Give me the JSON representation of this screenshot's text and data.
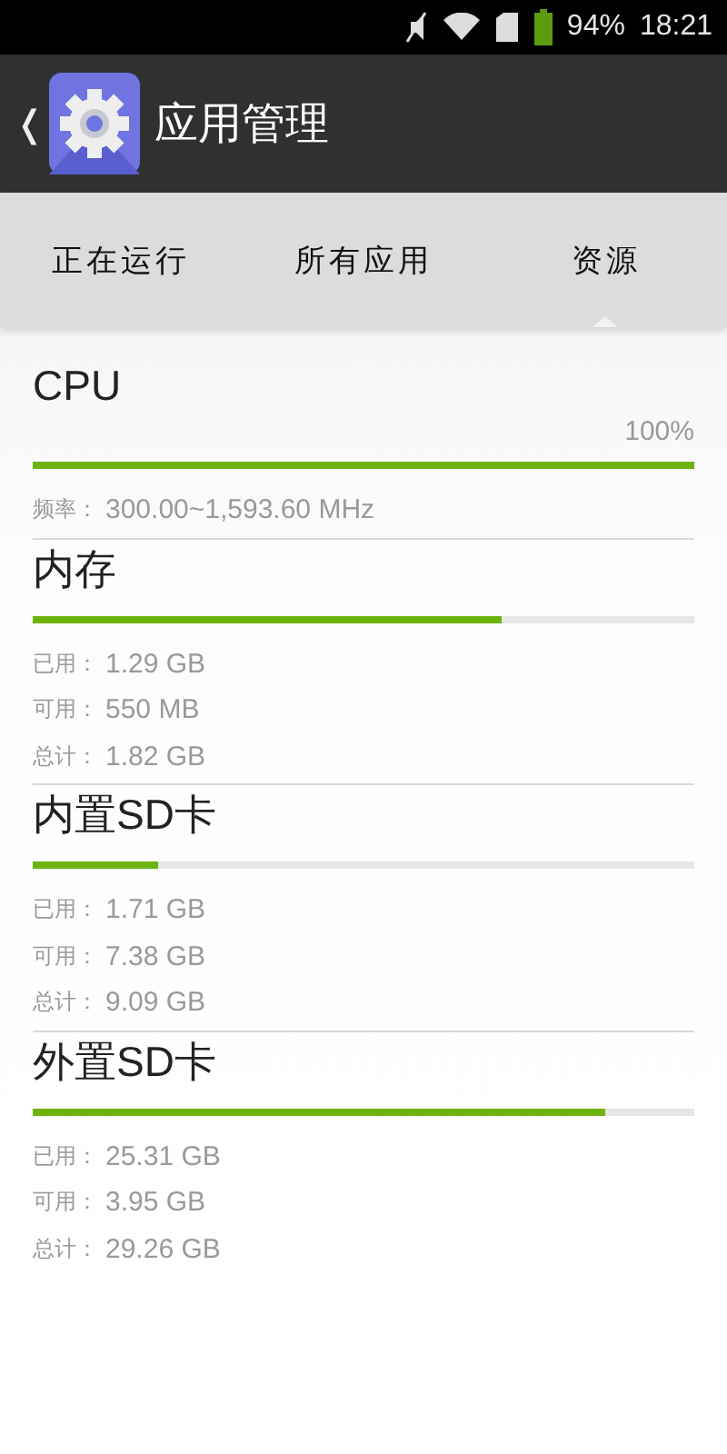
{
  "status_bar": {
    "battery": "94%",
    "time": "18:21"
  },
  "app_bar": {
    "title": "应用管理",
    "back": "❬"
  },
  "tabs": [
    {
      "label": "正在运行",
      "selected": false
    },
    {
      "label": "所有应用",
      "selected": false
    },
    {
      "label": "资源",
      "selected": true
    }
  ],
  "sections": [
    {
      "title": "CPU",
      "reading": "100%",
      "level": 1.0,
      "details": [
        {
          "label": "频率：",
          "value": "300.00~1,593.60 MHz"
        }
      ]
    },
    {
      "title": "内存",
      "level": 0.71,
      "details": [
        {
          "label": "已用：",
          "value": "1.29 GB"
        },
        {
          "label": "可用：",
          "value": "550 MB"
        },
        {
          "label": "总计：",
          "value": "1.82 GB"
        }
      ]
    },
    {
      "title": "内置SD卡",
      "level": 0.19,
      "details": [
        {
          "label": "已用：",
          "value": "1.71 GB"
        },
        {
          "label": "可用：",
          "value": "7.38 GB"
        },
        {
          "label": "总计：",
          "value": "9.09 GB"
        }
      ]
    },
    {
      "title": "外置SD卡",
      "level": 0.865,
      "details": [
        {
          "label": "已用：",
          "value": "25.31 GB"
        },
        {
          "label": "可用：",
          "value": "3.95 GB"
        },
        {
          "label": "总计：",
          "value": "29.26 GB"
        }
      ]
    }
  ]
}
